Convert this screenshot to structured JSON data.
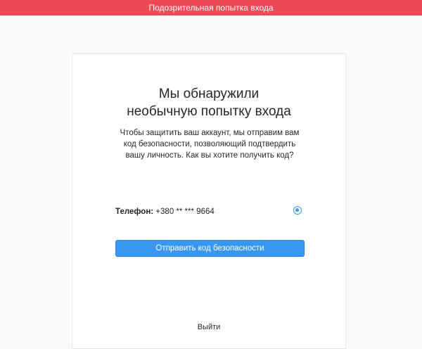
{
  "banner": {
    "text": "Подозрительная попытка входа"
  },
  "card": {
    "heading_lines": [
      "Мы обнаружили",
      "необычную попытку входа"
    ],
    "description_lines": [
      "Чтобы защитить ваш аккаунт, мы отправим вам",
      "код безопасности, позволяющий подтвердить",
      "вашу личность. Как вы хотите получить код?"
    ],
    "option": {
      "label": "Телефон:",
      "value": "+380 ** *** 9664",
      "selected": true
    },
    "submit_label": "Отправить код безопасности",
    "logout_label": "Выйти"
  },
  "colors": {
    "banner": "#ed4956",
    "accent": "#3897f0",
    "background": "#fafafa",
    "card": "#ffffff"
  }
}
